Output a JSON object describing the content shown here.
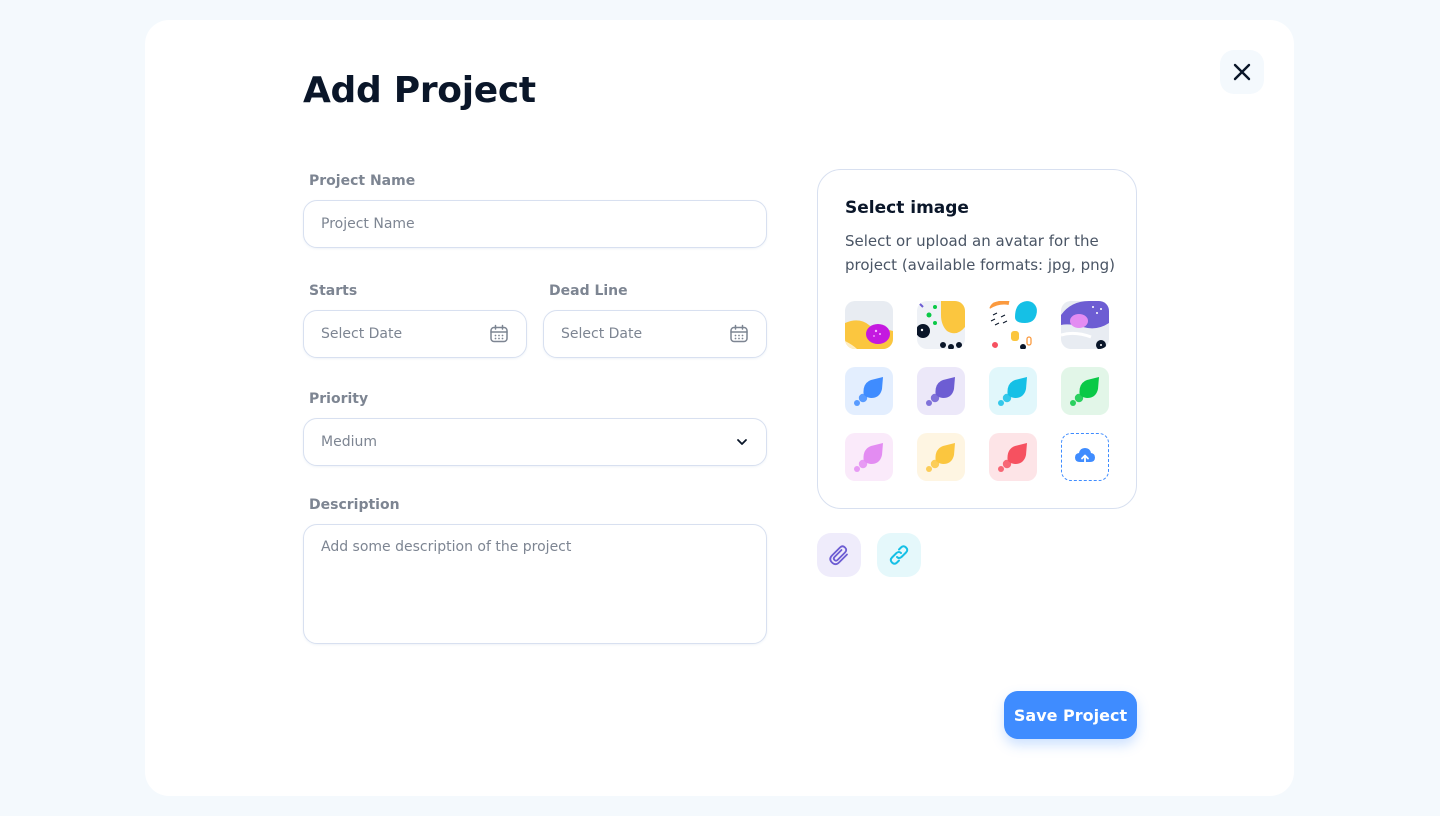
{
  "modal": {
    "title": "Add Project",
    "close_icon": "close-icon"
  },
  "form": {
    "project_name": {
      "label": "Project Name",
      "placeholder": "Project Name",
      "value": ""
    },
    "starts": {
      "label": "Starts",
      "placeholder": "Select Date",
      "icon": "calendar-icon"
    },
    "deadline": {
      "label": "Dead Line",
      "placeholder": "Select Date",
      "icon": "calendar-icon"
    },
    "priority": {
      "label": "Priority",
      "value": "Medium",
      "icon": "chevron-down-icon"
    },
    "description": {
      "label": "Description",
      "placeholder": "Add some description of the project"
    }
  },
  "image_picker": {
    "title": "Select image",
    "description": "Select or upload an avatar for the project (available formats: jpg, png)",
    "avatars": [
      {
        "name": "abstract-pattern-1",
        "bg": "#e8ecf2"
      },
      {
        "name": "abstract-pattern-2",
        "bg": "#eef1f6"
      },
      {
        "name": "abstract-pattern-3",
        "bg": "#ffffff"
      },
      {
        "name": "abstract-pattern-4",
        "bg": "#e8ecf2"
      },
      {
        "name": "drop-icon-blue",
        "bg": "#e3eefe",
        "color": "#3f8cff"
      },
      {
        "name": "drop-icon-purple",
        "bg": "#ece8f9",
        "color": "#6d5dd3"
      },
      {
        "name": "drop-icon-cyan",
        "bg": "#e1f7fb",
        "color": "#15c0e6"
      },
      {
        "name": "drop-icon-green",
        "bg": "#e2f6e8",
        "color": "#0ac947"
      },
      {
        "name": "drop-icon-pink",
        "bg": "#faeafa",
        "color": "#e38cf2"
      },
      {
        "name": "drop-icon-yellow",
        "bg": "#fef5e2",
        "color": "#fbc63f"
      },
      {
        "name": "drop-icon-red",
        "bg": "#fde4e7",
        "color": "#f65160"
      }
    ],
    "upload_icon": "cloud-upload-icon"
  },
  "attachments": {
    "attach_icon": "paperclip-icon",
    "attach_bg": "#efecfb",
    "link_icon": "link-icon",
    "link_bg": "#e5f8fb"
  },
  "actions": {
    "save_label": "Save Project"
  },
  "colors": {
    "accent": "#3f8cff",
    "heading": "#0a1629",
    "muted": "#7d8592",
    "border": "#d8e0f0"
  }
}
